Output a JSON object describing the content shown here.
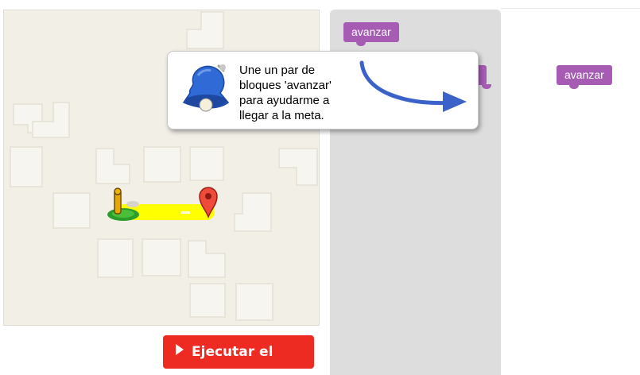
{
  "maze": {
    "colors": {
      "background": "#f2efe7",
      "path": "#ffff00",
      "wall_outline": "#e4e0d6"
    }
  },
  "toolbox": {
    "block_label": "avanzar",
    "block_color": "#a55cb2",
    "background": "#dddddd"
  },
  "workspace": {
    "block_label": "avanzar"
  },
  "dialog": {
    "text_lines": [
      "Une un par de",
      "bloques 'avanzar'",
      "para ayudarme a",
      "llegar a la meta."
    ],
    "icon": "bell-icon"
  },
  "run_button": {
    "label": "Ejecutar el",
    "color": "#ee2b23"
  }
}
